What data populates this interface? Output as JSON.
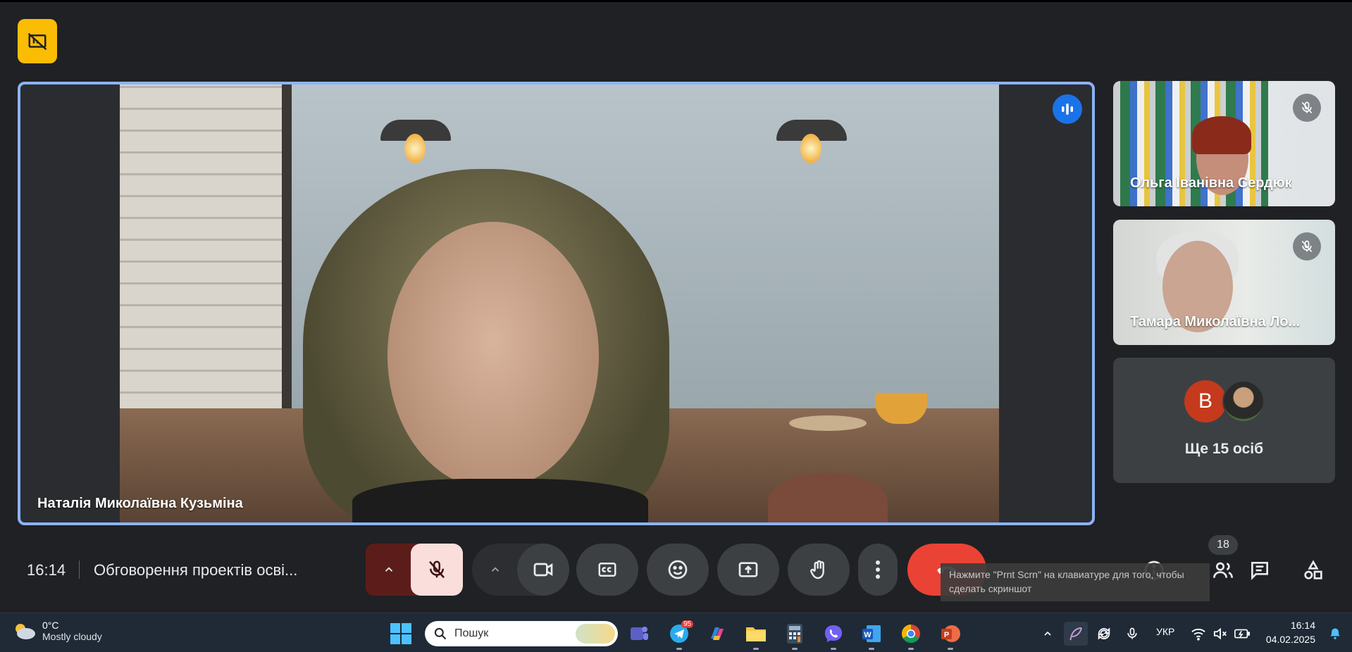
{
  "main_tile": {
    "name": "Наталія Миколаївна Кузьміна"
  },
  "side_tiles": [
    {
      "name": "Ольга Іванівна Сердюк"
    },
    {
      "name": "Тамара Миколаївна Ло..."
    }
  ],
  "others_tile": {
    "avatar_letter": "B",
    "label": "Ще 15 осіб"
  },
  "bottom_bar": {
    "time": "16:14",
    "meeting_title": "Обговорення проектів осві...",
    "participant_count": "18"
  },
  "toast": {
    "text": "Нажмите \"Prnt Scrn\" на клавиатуре для того, чтобы сделать скриншот"
  },
  "taskbar": {
    "weather_temp": "0°C",
    "weather_condition": "Mostly cloudy",
    "search_placeholder": "Пошук",
    "telegram_badge": "95",
    "language": "УКР",
    "time": "16:14",
    "date": "04.02.2025"
  },
  "colors": {
    "accent_blue": "#8ab4f8",
    "hangup_red": "#ea4335",
    "present_yellow": "#fbbc04",
    "mic_off_bg": "#f9dedc"
  }
}
